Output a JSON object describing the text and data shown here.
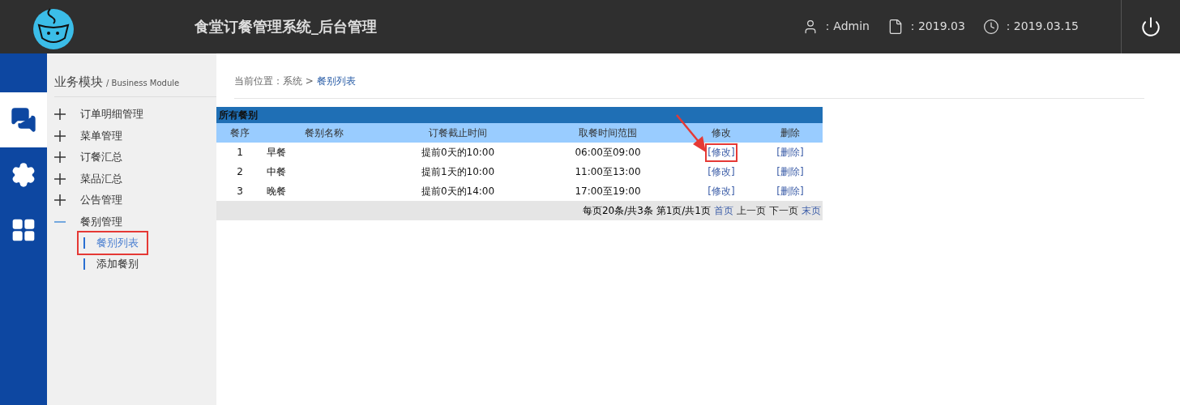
{
  "header": {
    "title": "食堂订餐管理系统_后台管理",
    "user": "：Admin",
    "month": "：2019.03",
    "date": "：2019.03.15"
  },
  "rail": [
    {
      "selected": true
    },
    {
      "selected": false
    },
    {
      "selected": false
    }
  ],
  "sidebar": {
    "title": "业务模块",
    "subtitle": "/ Business Module",
    "items": [
      {
        "label": "订单明细管理",
        "expanded": false
      },
      {
        "label": "菜单管理",
        "expanded": false
      },
      {
        "label": "订餐汇总",
        "expanded": false
      },
      {
        "label": "菜品汇总",
        "expanded": false
      },
      {
        "label": "公告管理",
        "expanded": false
      },
      {
        "label": "餐别管理",
        "expanded": true,
        "children": [
          {
            "label": "餐别列表",
            "selected": true,
            "highlighted": true
          },
          {
            "label": "添加餐别",
            "selected": false,
            "highlighted": false
          }
        ]
      }
    ]
  },
  "breadcrumb": {
    "prefix": "当前位置：系统 >",
    "current": "餐别列表"
  },
  "table": {
    "caption": "所有餐别",
    "columns": [
      "餐序",
      "餐别名称",
      "订餐截止时间",
      "取餐时间范围",
      "修改",
      "删除"
    ],
    "rows": [
      {
        "cells": [
          "1",
          "早餐",
          "提前0天的10:00",
          "06:00至09:00"
        ],
        "edit": "[修改]",
        "delete": "[删除]",
        "highlighted": true
      },
      {
        "cells": [
          "2",
          "中餐",
          "提前1天的10:00",
          "11:00至13:00"
        ],
        "edit": "[修改]",
        "delete": "[删除]",
        "highlighted": false
      },
      {
        "cells": [
          "3",
          "晚餐",
          "提前0天的14:00",
          "17:00至19:00"
        ],
        "edit": "[修改]",
        "delete": "[删除]",
        "highlighted": false
      }
    ],
    "pager": {
      "summary": "每页20条/共3条 第1页/共1页",
      "links": [
        {
          "label": "首页",
          "enabled": true
        },
        {
          "label": "上一页",
          "enabled": false
        },
        {
          "label": "下一页",
          "enabled": false
        },
        {
          "label": "末页",
          "enabled": true
        }
      ]
    }
  }
}
